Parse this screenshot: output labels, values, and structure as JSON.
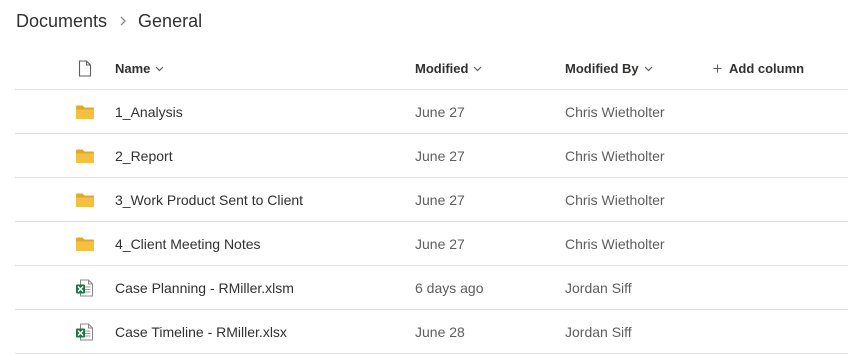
{
  "breadcrumb": {
    "root": "Documents",
    "current": "General"
  },
  "columns": {
    "type_icon": "file-type-icon",
    "name": "Name",
    "modified": "Modified",
    "modified_by": "Modified By",
    "add_column": "Add column"
  },
  "colors": {
    "folder": "#f4c042",
    "excel": "#217346",
    "divider": "#e1dfdd"
  },
  "files": [
    {
      "icon": "folder-icon",
      "name": "1_Analysis",
      "modified": "June 27",
      "modified_by": "Chris Wietholter"
    },
    {
      "icon": "folder-icon",
      "name": "2_Report",
      "modified": "June 27",
      "modified_by": "Chris Wietholter"
    },
    {
      "icon": "folder-icon",
      "name": "3_Work Product Sent to Client",
      "modified": "June 27",
      "modified_by": "Chris Wietholter"
    },
    {
      "icon": "folder-icon",
      "name": "4_Client Meeting Notes",
      "modified": "June 27",
      "modified_by": "Chris Wietholter"
    },
    {
      "icon": "excel-file-icon",
      "name": "Case Planning - RMiller.xlsm",
      "modified": "6 days ago",
      "modified_by": "Jordan Siff"
    },
    {
      "icon": "excel-file-icon",
      "name": "Case Timeline - RMiller.xlsx",
      "modified": "June 28",
      "modified_by": "Jordan Siff"
    }
  ]
}
